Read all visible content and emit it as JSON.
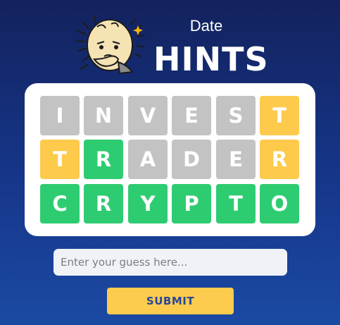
{
  "header": {
    "subtitle": "Date",
    "title": "HINTS",
    "mascot_icon": "egg-thinking-mascot-icon"
  },
  "colors": {
    "absent": "#c3c3c3",
    "present": "#fdca4c",
    "correct": "#2ecc71",
    "submit_bg": "#fdcb4e",
    "submit_text": "#27489a"
  },
  "board": {
    "rows": [
      {
        "tiles": [
          {
            "letter": "I",
            "state": "absent"
          },
          {
            "letter": "N",
            "state": "absent"
          },
          {
            "letter": "V",
            "state": "absent"
          },
          {
            "letter": "E",
            "state": "absent"
          },
          {
            "letter": "S",
            "state": "absent"
          },
          {
            "letter": "T",
            "state": "present"
          }
        ]
      },
      {
        "tiles": [
          {
            "letter": "T",
            "state": "present"
          },
          {
            "letter": "R",
            "state": "correct"
          },
          {
            "letter": "A",
            "state": "absent"
          },
          {
            "letter": "D",
            "state": "absent"
          },
          {
            "letter": "E",
            "state": "absent"
          },
          {
            "letter": "R",
            "state": "present"
          }
        ]
      },
      {
        "tiles": [
          {
            "letter": "C",
            "state": "correct"
          },
          {
            "letter": "R",
            "state": "correct"
          },
          {
            "letter": "Y",
            "state": "correct"
          },
          {
            "letter": "P",
            "state": "correct"
          },
          {
            "letter": "T",
            "state": "correct"
          },
          {
            "letter": "O",
            "state": "correct"
          }
        ]
      }
    ]
  },
  "guess": {
    "value": "",
    "placeholder": "Enter your guess here..."
  },
  "submit": {
    "label": "SUBMIT"
  }
}
